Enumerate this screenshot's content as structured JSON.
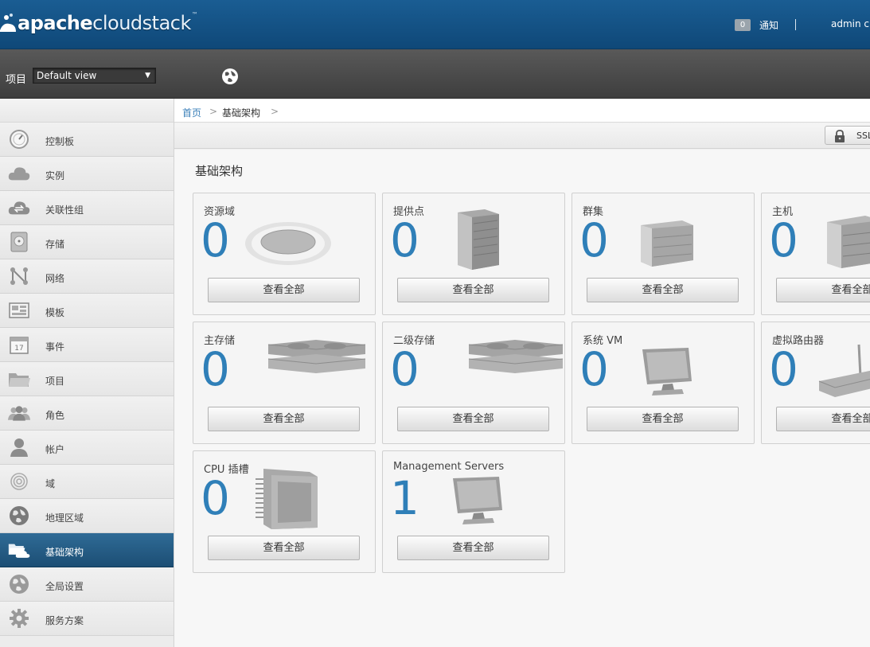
{
  "header": {
    "logo_text_bold": "apache",
    "logo_text_light": "cloudstack",
    "logo_tm": "™",
    "notification_count": "0",
    "notification_label": "通知",
    "separator": "|",
    "user_label": "admin cl"
  },
  "project_bar": {
    "label": "项目",
    "selected_project": "Default view"
  },
  "sidebar": {
    "items": [
      {
        "label": "控制板",
        "icon": "dashboard-gauge-icon"
      },
      {
        "label": "实例",
        "icon": "cloud-icon"
      },
      {
        "label": "关联性组",
        "icon": "cloud-exchange-icon"
      },
      {
        "label": "存储",
        "icon": "disk-icon"
      },
      {
        "label": "网络",
        "icon": "network-nodes-icon"
      },
      {
        "label": "模板",
        "icon": "template-icon"
      },
      {
        "label": "事件",
        "icon": "calendar-icon"
      },
      {
        "label": "项目",
        "icon": "folder-icon"
      },
      {
        "label": "角色",
        "icon": "users-group-icon"
      },
      {
        "label": "帐户",
        "icon": "user-icon"
      },
      {
        "label": "域",
        "icon": "domain-rings-icon"
      },
      {
        "label": "地理区域",
        "icon": "globe-icon"
      },
      {
        "label": "基础架构",
        "icon": "folder-cloud-icon",
        "active": true
      },
      {
        "label": "全局设置",
        "icon": "globe-settings-icon"
      },
      {
        "label": "服务方案",
        "icon": "gear-icon"
      }
    ],
    "calendar_day": "17"
  },
  "breadcrumb": {
    "home": "首页",
    "separator": ">",
    "current": "基础架构"
  },
  "toolbar": {
    "ssl_label": "SSL"
  },
  "main": {
    "title": "基础架构",
    "tiles": [
      {
        "title": "资源域",
        "count": "0",
        "button": "查看全部",
        "icon": "zone-disc-icon"
      },
      {
        "title": "提供点",
        "count": "0",
        "button": "查看全部",
        "icon": "rack-icon"
      },
      {
        "title": "群集",
        "count": "0",
        "button": "查看全部",
        "icon": "cluster-box-icon"
      },
      {
        "title": "主机",
        "count": "0",
        "button": "查看全部",
        "icon": "host-server-icon"
      },
      {
        "title": "主存储",
        "count": "0",
        "button": "查看全部",
        "icon": "primary-storage-icon"
      },
      {
        "title": "二级存储",
        "count": "0",
        "button": "查看全部",
        "icon": "secondary-storage-icon"
      },
      {
        "title": "系统 VM",
        "count": "0",
        "button": "查看全部",
        "icon": "monitor-icon"
      },
      {
        "title": "虚拟路由器",
        "count": "0",
        "button": "查看全部",
        "icon": "router-icon"
      },
      {
        "title": "CPU 插槽",
        "count": "0",
        "button": "查看全部",
        "icon": "cpu-chip-icon"
      },
      {
        "title": "Management Servers",
        "count": "1",
        "button": "查看全部",
        "icon": "monitor-icon"
      }
    ]
  },
  "colors": {
    "header_blue": "#1a5d93",
    "active_nav": "#245a82",
    "count_blue": "#2f7fb8"
  }
}
